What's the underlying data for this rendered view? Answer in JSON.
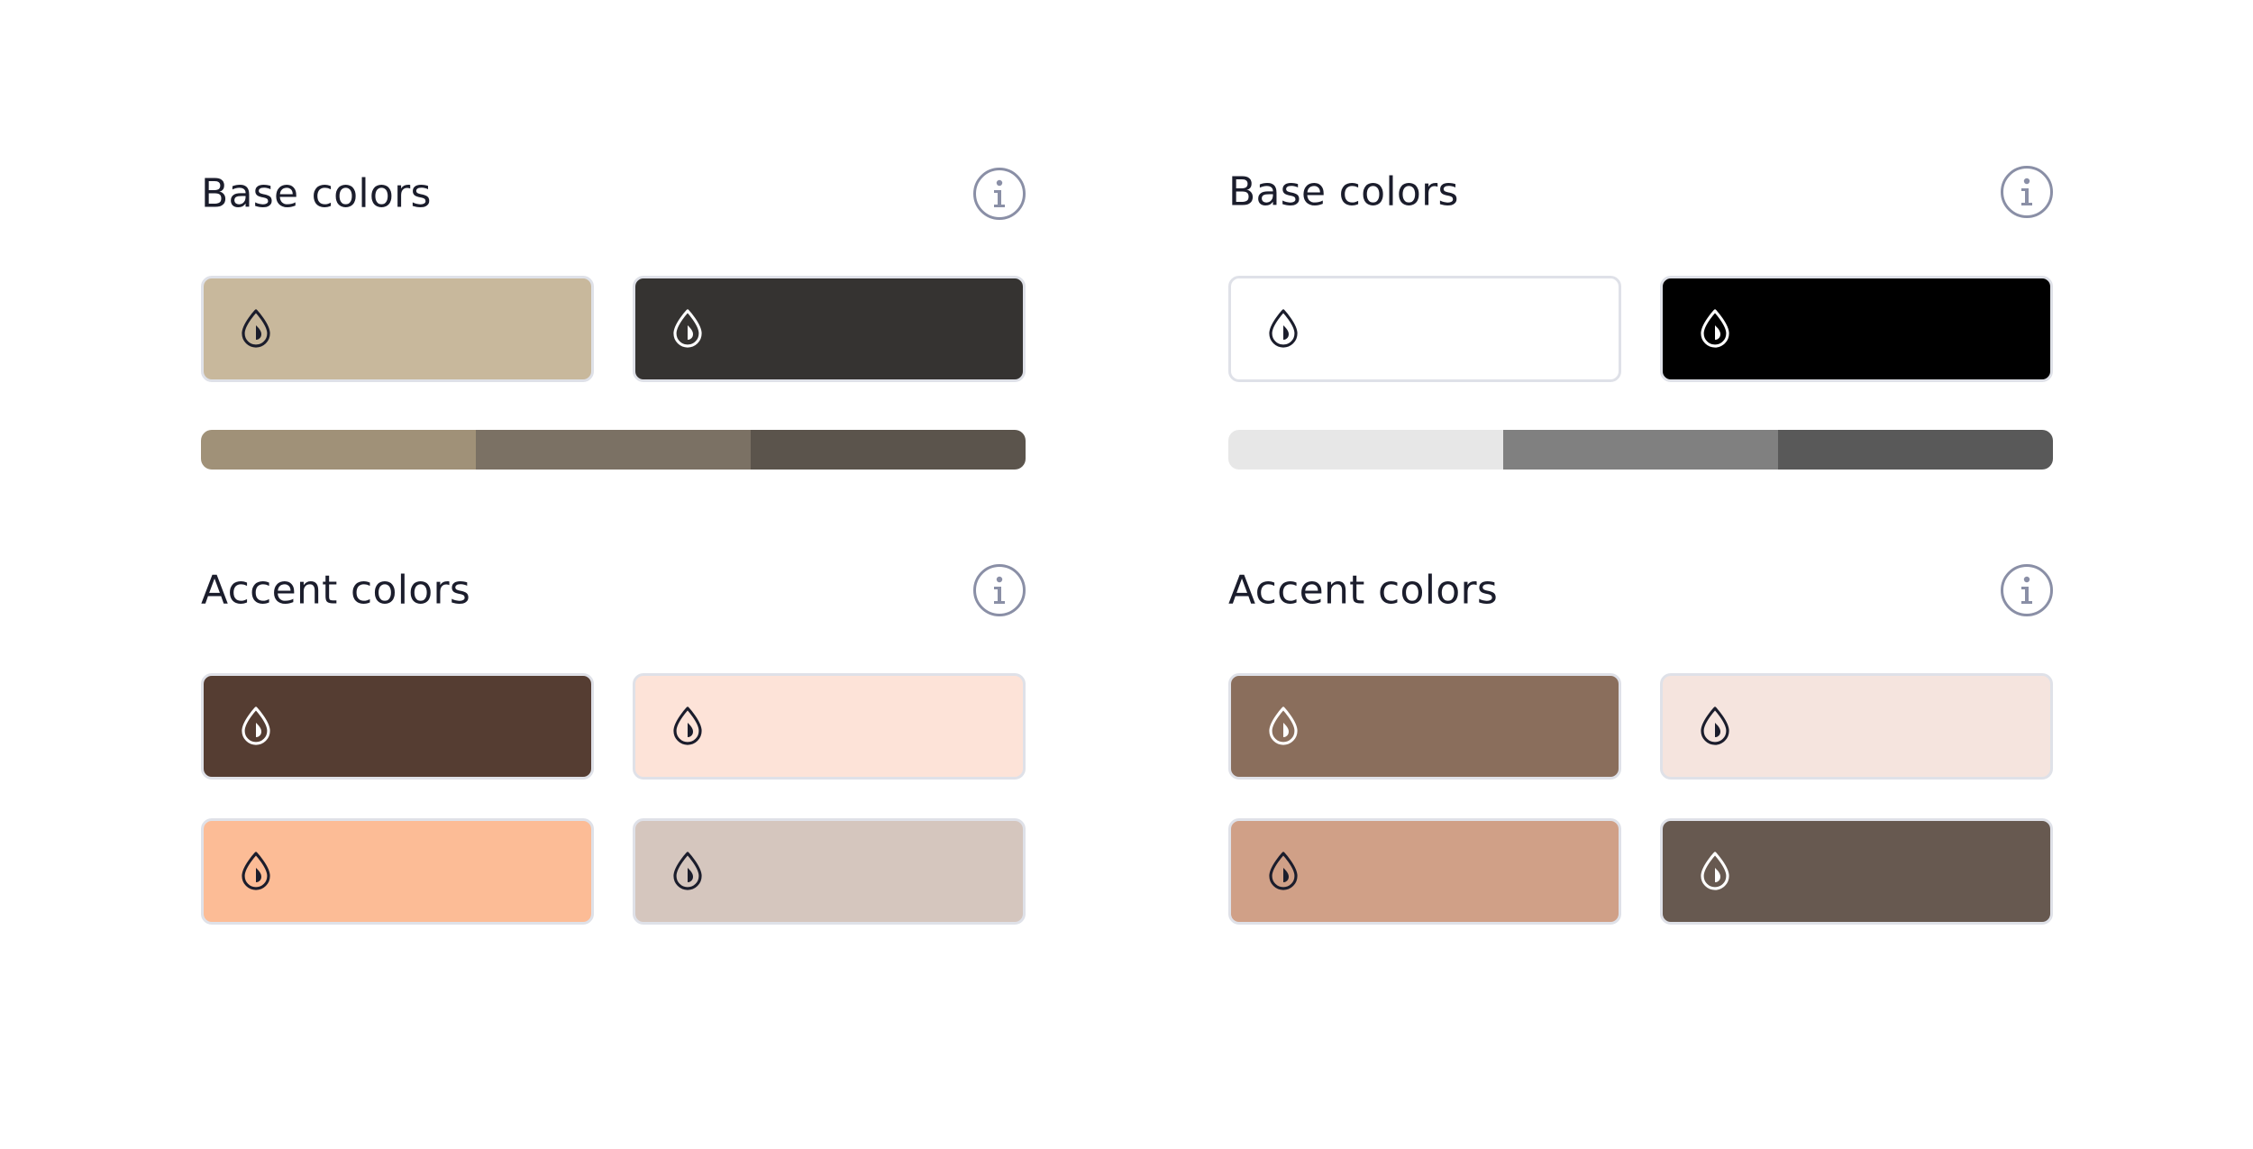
{
  "left": {
    "base": {
      "title": "Base colors",
      "info_icon": "info-icon",
      "swatches": [
        {
          "color": "#c8b89c",
          "icon": "color-drop-icon",
          "icon_color": "#1b1d2c"
        },
        {
          "color": "#353331",
          "icon": "color-drop-icon",
          "icon_color": "#ffffff"
        }
      ],
      "ramp": [
        "#a09178",
        "#7b7164",
        "#5b544c"
      ]
    },
    "accent": {
      "title": "Accent colors",
      "info_icon": "info-icon",
      "swatches": [
        {
          "color": "#553d32",
          "icon": "color-drop-icon",
          "icon_color": "#ffffff"
        },
        {
          "color": "#fde3d8",
          "icon": "color-drop-icon",
          "icon_color": "#1b1d2c"
        },
        {
          "color": "#fcbc96",
          "icon": "color-drop-icon",
          "icon_color": "#1b1d2c"
        },
        {
          "color": "#d5c6be",
          "icon": "color-drop-icon",
          "icon_color": "#1b1d2c"
        }
      ]
    }
  },
  "right": {
    "base": {
      "title": "Base colors",
      "info_icon": "info-icon",
      "swatches": [
        {
          "color": "#ffffff",
          "icon": "color-drop-icon",
          "icon_color": "#1b1d2c"
        },
        {
          "color": "#000000",
          "icon": "color-drop-icon",
          "icon_color": "#ffffff"
        }
      ],
      "ramp": [
        "#e7e7e7",
        "#808080",
        "#595959"
      ]
    },
    "accent": {
      "title": "Accent colors",
      "info_icon": "info-icon",
      "swatches": [
        {
          "color": "#8a6e5c",
          "icon": "color-drop-icon",
          "icon_color": "#ffffff"
        },
        {
          "color": "#f5e4de",
          "icon": "color-drop-icon",
          "icon_color": "#1b1d2c"
        },
        {
          "color": "#d0a087",
          "icon": "color-drop-icon",
          "icon_color": "#1b1d2c"
        },
        {
          "color": "#675950",
          "icon": "color-drop-icon",
          "icon_color": "#ffffff"
        }
      ]
    }
  }
}
